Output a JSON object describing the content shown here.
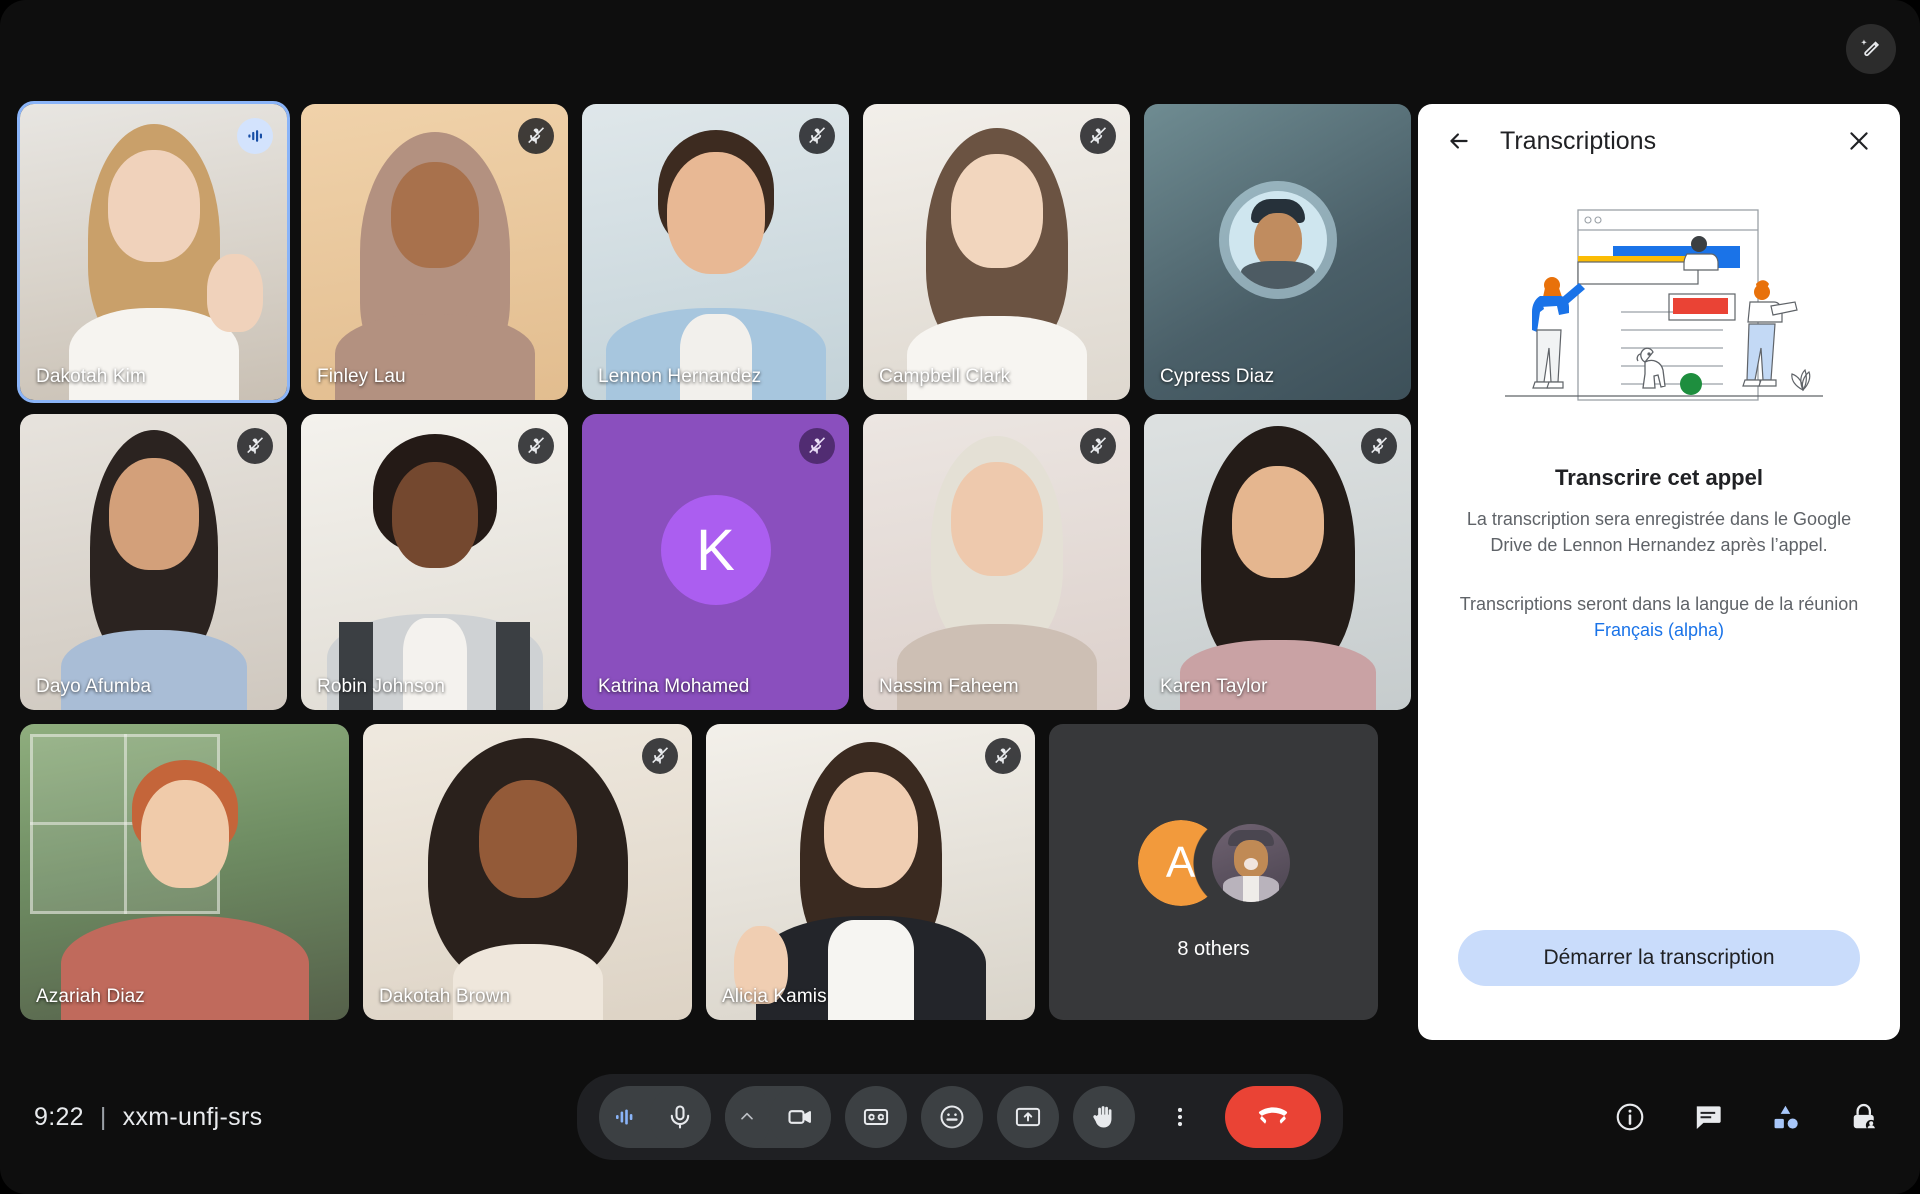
{
  "meeting": {
    "time": "9:22",
    "separator": "|",
    "code": "xxm-unfj-srs"
  },
  "effects_button": {
    "icon": "magic-wand-icon"
  },
  "participants": [
    {
      "name": "Dakotah Kim",
      "muted": false,
      "speaking": true,
      "type": "video",
      "bg": "bg-room"
    },
    {
      "name": "Finley Lau",
      "muted": true,
      "speaking": false,
      "type": "video",
      "bg": "bg-tan"
    },
    {
      "name": "Lennon Hernandez",
      "muted": true,
      "speaking": false,
      "type": "video",
      "bg": "bg-blue"
    },
    {
      "name": "Campbell Clark",
      "muted": true,
      "speaking": false,
      "type": "video",
      "bg": "bg-white"
    },
    {
      "name": "Cypress Diaz",
      "muted": false,
      "speaking": false,
      "type": "avatar-photo",
      "bg": "bg-teal"
    },
    {
      "name": "Dayo Afumba",
      "muted": true,
      "speaking": false,
      "type": "video",
      "bg": "bg-soft"
    },
    {
      "name": "Robin Johnson",
      "muted": true,
      "speaking": false,
      "type": "video",
      "bg": "bg-bright"
    },
    {
      "name": "Katrina Mohamed",
      "muted": true,
      "speaking": false,
      "type": "initial",
      "initial": "K",
      "bg": "bg-purple"
    },
    {
      "name": "Nassim Faheem",
      "muted": true,
      "speaking": false,
      "type": "video",
      "bg": "bg-pinkish"
    },
    {
      "name": "Karen Taylor",
      "muted": true,
      "speaking": false,
      "type": "video",
      "bg": "bg-grey"
    },
    {
      "name": "Azariah Diaz",
      "muted": false,
      "speaking": false,
      "type": "video",
      "bg": "bg-window"
    },
    {
      "name": "Dakotah Brown",
      "muted": true,
      "speaking": false,
      "type": "video",
      "bg": "bg-cream"
    },
    {
      "name": "Alicia Kamis",
      "muted": true,
      "speaking": false,
      "type": "video",
      "bg": "bg-studio"
    }
  ],
  "others_tile": {
    "label": "8 others",
    "avatar_initial": "A",
    "avatar_color": "#f29a3c"
  },
  "panel": {
    "back_icon": "arrow-back-icon",
    "title": "Transcriptions",
    "close_icon": "close-icon",
    "illustration": "transcription-illustration",
    "heading": "Transcrire cet appel",
    "body_1": "La transcription sera enregistrée dans le Google Drive de Lennon Hernandez après l’appel.",
    "body_2_prefix": "Transcriptions seront dans la langue de la réunion ",
    "body_2_link": "Français (alpha)",
    "start_button": "Démarrer la transcription"
  },
  "toolbar": {
    "audio_indicator": "audio-waveform-icon",
    "mic": "microphone-icon",
    "camera_chevron": "chevron-up-icon",
    "camera": "camera-icon",
    "captions": "closed-captions-icon",
    "reactions": "emoji-icon",
    "present": "present-screen-icon",
    "raise_hand": "raise-hand-icon",
    "more": "more-options-icon",
    "end_call": "end-call-icon"
  },
  "right_icons": {
    "info": "info-icon",
    "chat": "chat-icon",
    "activities": "activities-icon",
    "host_controls": "host-lock-icon"
  },
  "colors": {
    "accent_blue": "#8ab4f8",
    "link_blue": "#1a73e8",
    "end_call_red": "#ea4335",
    "button_blue": "#c9dcfb",
    "avatar_purple": "#8a4fbe",
    "avatar_orange": "#f29a3c"
  }
}
